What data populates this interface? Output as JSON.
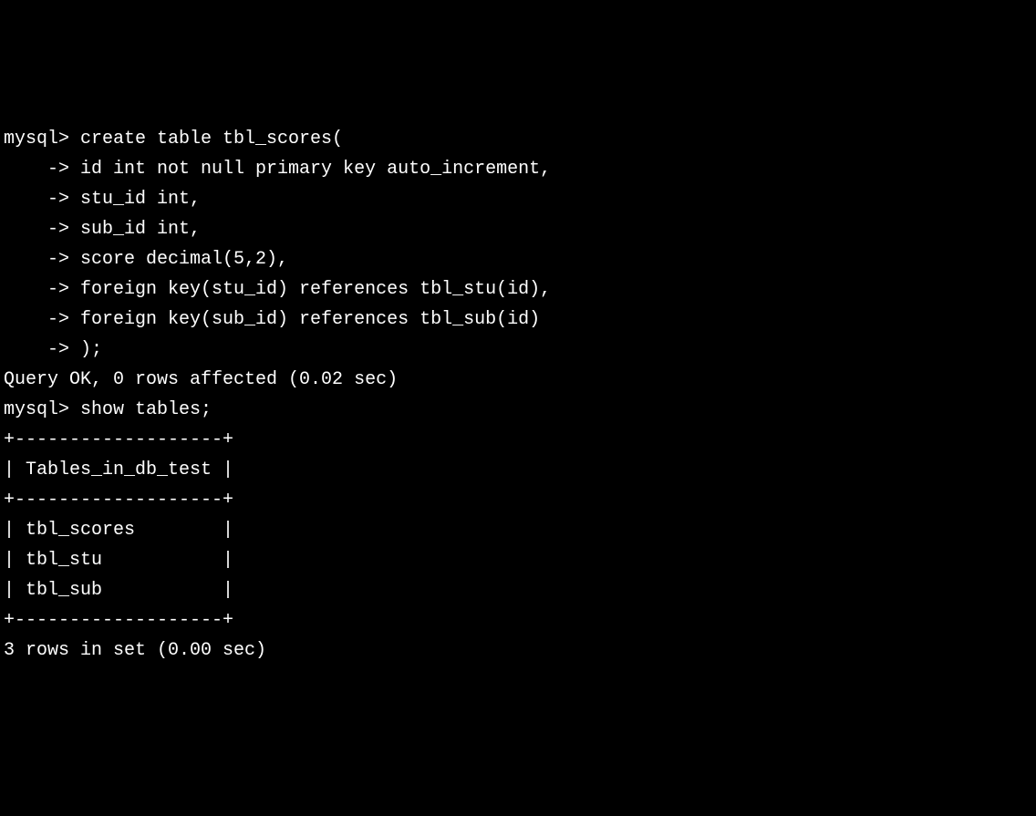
{
  "terminal": {
    "lines": [
      "mysql> create table tbl_scores(",
      "    -> id int not null primary key auto_increment,",
      "    -> stu_id int,",
      "    -> sub_id int,",
      "    -> score decimal(5,2),",
      "    -> foreign key(stu_id) references tbl_stu(id),",
      "    -> foreign key(sub_id) references tbl_sub(id)",
      "    -> );",
      "Query OK, 0 rows affected (0.02 sec)",
      "",
      "mysql> show tables;",
      "+-------------------+",
      "| Tables_in_db_test |",
      "+-------------------+",
      "| tbl_scores        |",
      "| tbl_stu           |",
      "| tbl_sub           |",
      "+-------------------+",
      "3 rows in set (0.00 sec)"
    ]
  }
}
